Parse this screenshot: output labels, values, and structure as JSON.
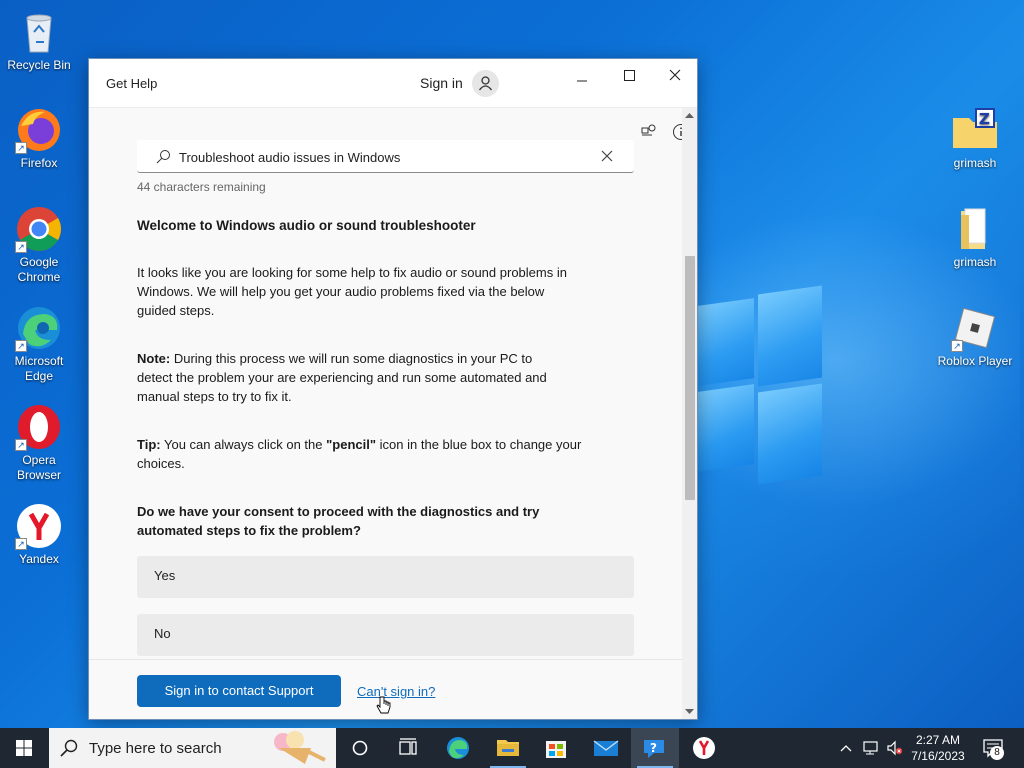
{
  "desktop": {
    "icons_left": [
      {
        "label": "Recycle Bin"
      },
      {
        "label": "Firefox"
      },
      {
        "label": "Google Chrome"
      },
      {
        "label": "Microsoft Edge"
      },
      {
        "label": "Opera Browser"
      },
      {
        "label": "Yandex"
      }
    ],
    "icons_right": [
      {
        "label": "grimash"
      },
      {
        "label": "grimash"
      },
      {
        "label": "Roblox Player"
      }
    ]
  },
  "window": {
    "app_title": "Get Help",
    "sign_in_label": "Sign in",
    "search": {
      "value": "Troubleshoot audio issues in Windows",
      "chars_remaining": "44 characters remaining"
    },
    "heading": "Welcome to Windows audio or sound troubleshooter",
    "intro": "It looks like you are looking for some help to fix audio or sound problems in Windows. We will help you get your audio problems fixed via the below guided steps.",
    "note_label": "Note:",
    "note_text": "During this process we will run some diagnostics in your PC to detect the problem your are experiencing and run some automated and manual steps to try to fix it.",
    "tip_label": "Tip:",
    "tip_pre": "You can always click on the",
    "tip_bold": "\"pencil\"",
    "tip_post": "icon in the blue box to change your choices.",
    "question": "Do we have your consent to proceed with the diagnostics and try automated steps to fix the problem?",
    "options": [
      "Yes",
      "No"
    ],
    "footer": {
      "primary_button": "Sign in to contact Support",
      "link": "Can't sign in?"
    }
  },
  "taskbar": {
    "search_placeholder": "Type here to search",
    "time": "2:27 AM",
    "date": "7/16/2023",
    "notification_count": "8"
  }
}
